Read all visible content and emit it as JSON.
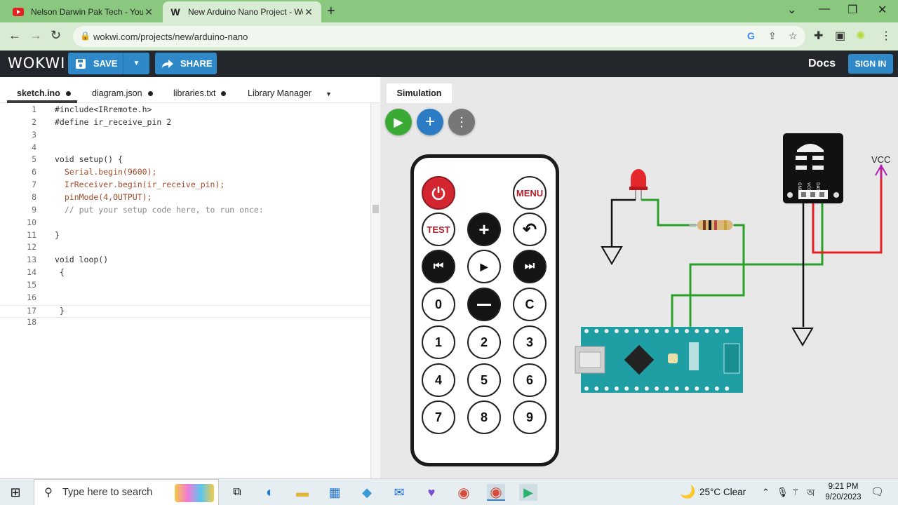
{
  "browser": {
    "tabs": [
      {
        "title": "Nelson Darwin Pak Tech - YouTu",
        "icon": "youtube-icon",
        "active": false
      },
      {
        "title": "New Arduino Nano Project - Wo",
        "icon": "wokwi-favicon-icon",
        "active": true
      }
    ],
    "url": "wokwi.com/projects/new/arduino-nano"
  },
  "wokwi": {
    "logo": "WOKWI",
    "save_label": "SAVE",
    "share_label": "SHARE",
    "docs_label": "Docs",
    "signin_label": "SIGN IN"
  },
  "editor": {
    "tabs": [
      {
        "label": "sketch.ino",
        "modified": true
      },
      {
        "label": "diagram.json",
        "modified": true
      },
      {
        "label": "libraries.txt",
        "modified": true
      },
      {
        "label": "Library Manager",
        "modified": false
      }
    ],
    "lines": [
      "#include<IRremote.h>",
      "#define ir_receive_pin 2",
      "",
      "",
      "void setup() {",
      "  Serial.begin(9600);",
      "  IrReceiver.begin(ir_receive_pin);",
      "  pinMode(4,OUTPUT);",
      "  // put your setup code here, to run once:",
      "",
      "}",
      "",
      "void loop()",
      " {",
      "",
      "",
      " }",
      ""
    ],
    "line_numbers": [
      "1",
      "2",
      "3",
      "4",
      "5",
      "6",
      "7",
      "8",
      "9",
      "10",
      "11",
      "12",
      "13",
      "14",
      "15",
      "16",
      "17",
      "18"
    ]
  },
  "simulation": {
    "tab_label": "Simulation",
    "remote": {
      "rows": [
        [
          "power",
          "",
          "MENU"
        ],
        [
          "TEST",
          "+",
          "back"
        ],
        [
          "prev",
          "play",
          "next"
        ],
        [
          "0",
          "-",
          "C"
        ],
        [
          "1",
          "2",
          "3"
        ],
        [
          "4",
          "5",
          "6"
        ],
        [
          "7",
          "8",
          "9"
        ]
      ]
    },
    "vcc_label": "VCC",
    "ir_pins": [
      "GND",
      "VCC",
      "DAT"
    ]
  },
  "taskbar": {
    "search_placeholder": "Type here to search",
    "weather": "25°C  Clear",
    "time": "9:21 PM",
    "date": "9/20/2023"
  }
}
